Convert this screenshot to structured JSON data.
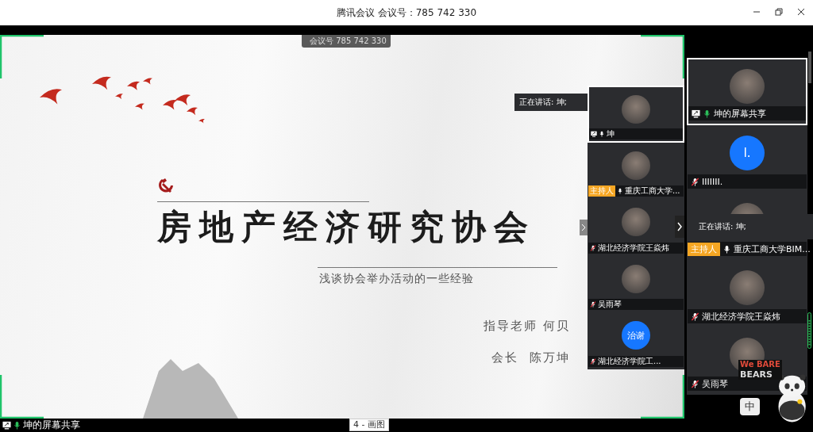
{
  "window": {
    "title": "腾讯会议 会议号：785 742 330"
  },
  "meeting_id_pill": "会议号 785 742 330",
  "slide": {
    "title": "房地产经济研究协会",
    "subtitle": "浅谈协会举办活动的一些经验",
    "advisor": "指导老师 何贝",
    "president": "会长  陈万坤"
  },
  "shared_strip": {
    "speaking": "正在讲话: 坤;",
    "tiles": [
      {
        "name": "坤",
        "sharing": true,
        "muted": false,
        "talking": false,
        "selected": true
      },
      {
        "name": "重庆工商大学...",
        "badge": "主持人",
        "sharing": false,
        "muted": false,
        "talking": false,
        "selected": false
      },
      {
        "name": "湖北经济学院王焱炜",
        "sharing": false,
        "muted": true,
        "talking": false,
        "selected": false
      },
      {
        "name": "吴雨琴",
        "sharing": false,
        "muted": true,
        "talking": false,
        "selected": false
      },
      {
        "name": "湖北经济学院工...",
        "initial": "治谢",
        "sharing": false,
        "muted": true,
        "talking": false,
        "selected": false
      }
    ]
  },
  "participants": {
    "speaking": "正在讲话: 坤;",
    "tiles": [
      {
        "name": "坤的屏幕共享",
        "sharing": true,
        "muted": false,
        "talking": true,
        "selected": true
      },
      {
        "name": "IIIIIII.",
        "initial": "I.",
        "sharing": false,
        "muted": true,
        "talking": false,
        "selected": false
      },
      {
        "name": "重庆工商大学BIM...",
        "badge": "主持人",
        "sharing": false,
        "muted": false,
        "talking": false,
        "selected": false
      },
      {
        "name": "湖北经济学院王焱炜",
        "sharing": false,
        "muted": true,
        "talking": false,
        "selected": false
      },
      {
        "name": "吴雨琴",
        "sharing": false,
        "muted": true,
        "talking": false,
        "selected": false
      }
    ]
  },
  "share_label": "坤的屏幕共享",
  "taskbar_tooltip": "4 - 画图",
  "ime": {
    "logo_top": "We BARE",
    "logo_bottom": "BEARS",
    "mode": "中"
  }
}
